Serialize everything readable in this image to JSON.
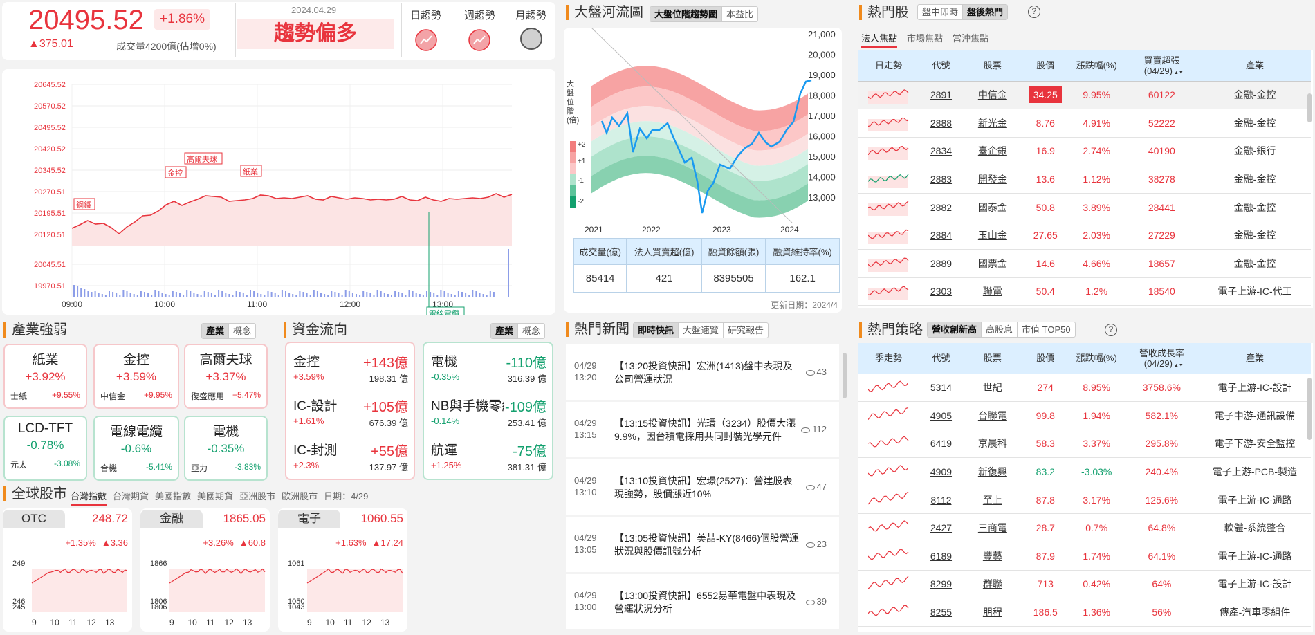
{
  "index": {
    "value": "20495.52",
    "pct": "+1.86%",
    "change": "▲375.01",
    "volume": "成交量4200億(估增0%)",
    "date": "2024.04.29",
    "trend_text": "趨勢偏多",
    "trend_labels": [
      "日趨勢",
      "週趨勢",
      "月趨勢"
    ]
  },
  "intraday": {
    "y_ticks": [
      "20645.52",
      "20570.52",
      "20495.52",
      "20420.52",
      "20345.52",
      "20270.51",
      "20195.51",
      "20120.51",
      "20045.51",
      "19970.51"
    ],
    "x_ticks": [
      "09:00",
      "10:00",
      "11:00",
      "12:00",
      "13:00"
    ],
    "tags": [
      "鋼鐵",
      "金控",
      "高爾夫球",
      "紙業",
      "電線電纜"
    ]
  },
  "river": {
    "title": "大盤河流圖",
    "tabs": [
      "大盤位階趨勢圖",
      "本益比"
    ],
    "y_ticks": [
      "21,000",
      "20,000",
      "19,000",
      "18,000",
      "17,000",
      "16,000",
      "15,000",
      "14,000",
      "13,000"
    ],
    "x_ticks": [
      "2021",
      "2022",
      "2023",
      "2024"
    ],
    "side_label": "大盤位階(倍)",
    "bands": [
      "+2",
      "+1",
      "-1",
      "-2"
    ],
    "stats_headers": [
      "成交量(億)",
      "法人買賣超(億)",
      "融資餘額(張)",
      "融資維持率(%)"
    ],
    "stats_values": [
      "85414",
      "421",
      "8395505",
      "162.1"
    ],
    "updated": "更新日期：2024/4"
  },
  "hot": {
    "title": "熱門股",
    "tabs": [
      "盤中即時",
      "盤後熱門"
    ],
    "help": "?",
    "subtabs": [
      "法人焦點",
      "市場焦點",
      "當沖焦點"
    ],
    "headers": [
      "日走勢",
      "代號",
      "股票",
      "股價",
      "漲跌幅(%)",
      "買賣超張\n(04/29)",
      "產業"
    ],
    "rows": [
      [
        "2891",
        "中信金",
        "34.25",
        "9.95%",
        "60122",
        "金融-金控"
      ],
      [
        "2888",
        "新光金",
        "8.76",
        "4.91%",
        "52222",
        "金融-金控"
      ],
      [
        "2834",
        "臺企銀",
        "16.9",
        "2.74%",
        "40190",
        "金融-銀行"
      ],
      [
        "2883",
        "開發金",
        "13.6",
        "1.12%",
        "38278",
        "金融-金控"
      ],
      [
        "2882",
        "國泰金",
        "50.8",
        "3.89%",
        "28441",
        "金融-金控"
      ],
      [
        "2884",
        "玉山金",
        "27.65",
        "2.03%",
        "27229",
        "金融-金控"
      ],
      [
        "2889",
        "國票金",
        "14.6",
        "4.66%",
        "18657",
        "金融-金控"
      ],
      [
        "2303",
        "聯電",
        "50.4",
        "1.2%",
        "18540",
        "電子上游-IC-代工"
      ]
    ]
  },
  "industry": {
    "title": "產業強弱",
    "tabs": [
      "產業",
      "概念"
    ],
    "items": [
      {
        "name": "紙業",
        "pct": "+3.92%",
        "sub_name": "士紙",
        "sub_pct": "+9.55%",
        "dir": "up"
      },
      {
        "name": "金控",
        "pct": "+3.59%",
        "sub_name": "中信金",
        "sub_pct": "+9.95%",
        "dir": "up"
      },
      {
        "name": "高爾夫球",
        "pct": "+3.37%",
        "sub_name": "復盛應用",
        "sub_pct": "+5.47%",
        "dir": "up"
      },
      {
        "name": "LCD-TFT",
        "pct": "-0.78%",
        "sub_name": "元太",
        "sub_pct": "-3.08%",
        "dir": "dn"
      },
      {
        "name": "電線電纜",
        "pct": "-0.6%",
        "sub_name": "合機",
        "sub_pct": "-5.41%",
        "dir": "dn"
      },
      {
        "name": "電機",
        "pct": "-0.35%",
        "sub_name": "亞力",
        "sub_pct": "-3.83%",
        "dir": "dn"
      }
    ]
  },
  "funds": {
    "title": "資金流向",
    "tabs": [
      "產業",
      "概念"
    ],
    "up": [
      {
        "name": "金控",
        "amt": "+143億",
        "pct": "+3.59%",
        "vol": "198.31 億"
      },
      {
        "name": "IC-設計",
        "amt": "+105億",
        "pct": "+1.61%",
        "vol": "676.39 億"
      },
      {
        "name": "IC-封測",
        "amt": "+55億",
        "pct": "+2.3%",
        "vol": "137.97 億"
      }
    ],
    "down": [
      {
        "name": "電機",
        "amt": "-110億",
        "pct": "-0.35%",
        "vol": "316.39 億"
      },
      {
        "name": "NB與手機零組",
        "amt": "-109億",
        "pct": "-0.14%",
        "vol": "253.41 億"
      },
      {
        "name": "航運",
        "amt": "-75億",
        "pct": "+1.25%",
        "vol": "381.31 億"
      }
    ]
  },
  "news": {
    "title": "熱門新聞",
    "tabs": [
      "即時快訊",
      "大盤速覽",
      "研究報告"
    ],
    "items": [
      {
        "date": "04/29",
        "time": "13:20",
        "text": "【13:20投資快訊】宏洲(1413)盤中表現及公司營運狀況",
        "views": "43"
      },
      {
        "date": "04/29",
        "time": "13:15",
        "text": "【13:15投資快訊】光環（3234）股價大漲9.9%，因台積電採用共同封裝光學元件",
        "views": "112"
      },
      {
        "date": "04/29",
        "time": "13:10",
        "text": "【13:10投資快訊】宏璟(2527)：營建股表現強勢，股價漲近10%",
        "views": "47"
      },
      {
        "date": "04/29",
        "time": "13:05",
        "text": "【13:05投資快訊】美喆-KY(8466)個股營運狀況與股價訊號分析",
        "views": "23"
      },
      {
        "date": "04/29",
        "time": "13:00",
        "text": "【13:00投資快訊】6552易華電盤中表現及營運狀況分析",
        "views": "39"
      }
    ]
  },
  "strategy": {
    "title": "熱門策略",
    "tabs": [
      "營收創新高",
      "高股息",
      "市值 TOP50"
    ],
    "help": "?",
    "headers": [
      "季走勢",
      "代號",
      "股票",
      "股價",
      "漲跌幅(%)",
      "營收成長率\n(04/29)",
      "產業"
    ],
    "rows": [
      [
        "5314",
        "世紀",
        "274",
        "8.95%",
        "3758.6%",
        "電子上游-IC-設計"
      ],
      [
        "4905",
        "台聯電",
        "99.8",
        "1.94%",
        "582.1%",
        "電子中游-通訊設備"
      ],
      [
        "6419",
        "京晨科",
        "58.3",
        "3.37%",
        "295.8%",
        "電子下游-安全監控"
      ],
      [
        "4909",
        "新復興",
        "83.2",
        "-3.03%",
        "240.4%",
        "電子上游-PCB-製造"
      ],
      [
        "8112",
        "至上",
        "87.8",
        "3.17%",
        "125.6%",
        "電子上游-IC-通路"
      ],
      [
        "2427",
        "三商電",
        "28.7",
        "0.7%",
        "64.8%",
        "軟體-系統整合"
      ],
      [
        "6189",
        "豐藝",
        "87.9",
        "1.74%",
        "64.1%",
        "電子上游-IC-通路"
      ],
      [
        "8299",
        "群聯",
        "713",
        "0.42%",
        "64%",
        "電子上游-IC-設計"
      ],
      [
        "8255",
        "朋程",
        "186.5",
        "1.36%",
        "56%",
        "傳產-汽車零組件"
      ]
    ]
  },
  "global": {
    "title": "全球股市",
    "tabs": [
      "台灣指數",
      "台灣期貨",
      "美國指數",
      "美國期貨",
      "亞洲股市",
      "歐洲股市"
    ],
    "date": "日期：4/29",
    "cards": [
      {
        "name": "OTC",
        "value": "248.72",
        "pct": "+1.35%",
        "chg": "▲3.36",
        "y_ticks": [
          "249",
          "246",
          "245"
        ],
        "x_ticks": [
          "9",
          "10",
          "11",
          "12",
          "13"
        ]
      },
      {
        "name": "金融",
        "value": "1865.05",
        "pct": "+3.26%",
        "chg": "▲60.8",
        "y_ticks": [
          "1866",
          "1806",
          "1806"
        ],
        "x_ticks": [
          "9",
          "10",
          "11",
          "12",
          "13"
        ]
      },
      {
        "name": "電子",
        "value": "1060.55",
        "pct": "+1.63%",
        "chg": "▲17.24",
        "y_ticks": [
          "1061",
          "1050",
          "1043"
        ],
        "x_ticks": [
          "9",
          "10",
          "11",
          "12",
          "13"
        ]
      }
    ]
  }
}
